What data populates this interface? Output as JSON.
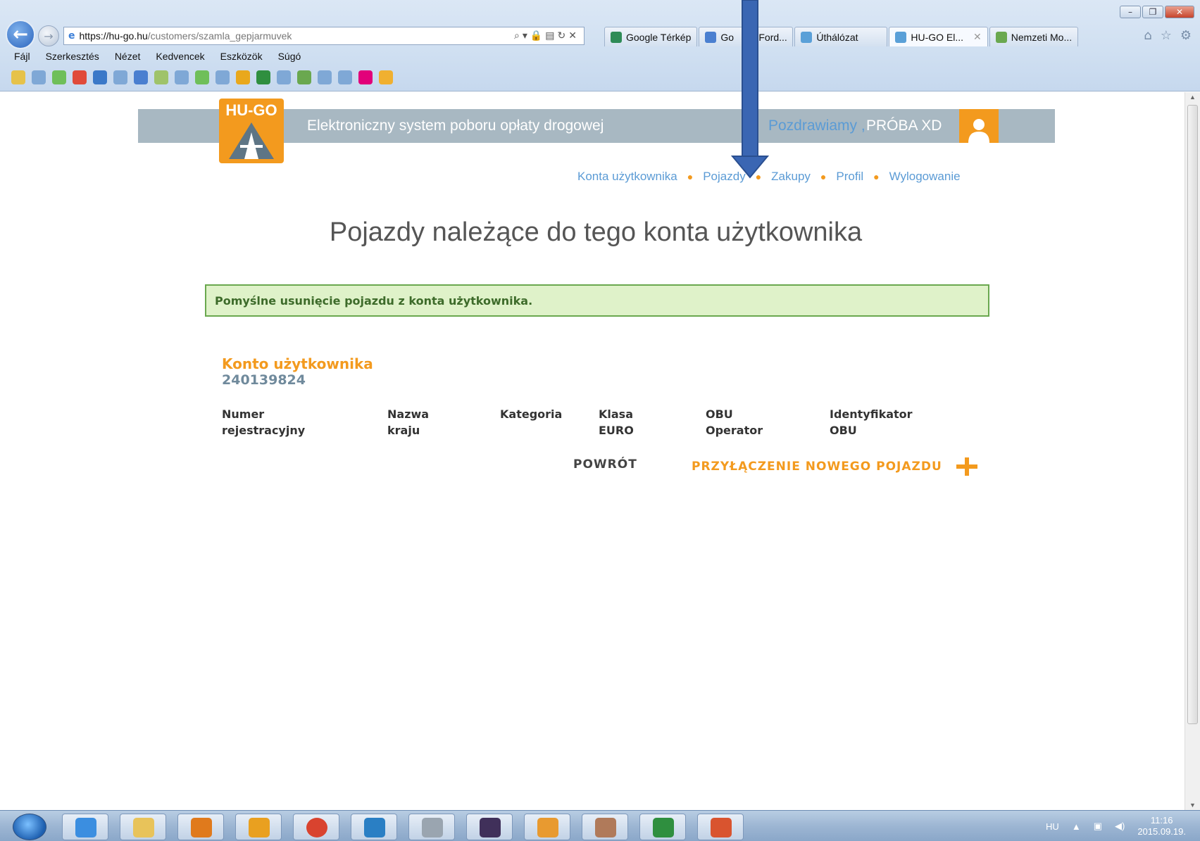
{
  "browser": {
    "url_host": "https://hu-go.hu",
    "url_path": "/customers/szamla_gepjarmuvek",
    "tabs": [
      {
        "label": "Google Térkép",
        "color": "#2e8b57"
      },
      {
        "label": "Go",
        "color": "#4a7fd0"
      },
      {
        "label": "Ford...",
        "color": "#4a7fd0"
      },
      {
        "label": "Úthálózat",
        "color": "#5aa0d8"
      },
      {
        "label": "HU-GO El...",
        "color": "#5aa0d8"
      },
      {
        "label": "Nemzeti Mo...",
        "color": "#6aa84f"
      }
    ],
    "menu": [
      "Fájl",
      "Szerkesztés",
      "Nézet",
      "Kedvencek",
      "Eszközök",
      "Súgó"
    ]
  },
  "header": {
    "logo_text": "HU-GO",
    "system_title": "Elektroniczny system poboru opłaty drogowej",
    "greeting": "Pozdrawiamy ,",
    "username": "PRÓBA XD"
  },
  "nav": {
    "items": [
      "Konta użytkownika",
      "Pojazdy",
      "Zakupy",
      "Profil",
      "Wylogowanie"
    ]
  },
  "main": {
    "heading": "Pojazdy należące do tego konta użytkownika",
    "success_message": "Pomyślne usunięcie pojazdu z konta użytkownika.",
    "account_label": "Konto użytkownika",
    "account_number": "240139824",
    "columns": [
      [
        "Numer",
        "rejestracyjny"
      ],
      [
        "Nazwa",
        "kraju"
      ],
      [
        "Kategoria"
      ],
      [
        "Klasa",
        "EURO"
      ],
      [
        "OBU",
        "Operator"
      ],
      [
        "Identyfikator",
        "OBU"
      ]
    ],
    "back_label": "POWRÓT",
    "add_vehicle_label": "PRZYŁĄCZENIE NOWEGO POJAZDU"
  },
  "taskbar": {
    "lang": "HU",
    "time": "11:16",
    "date": "2015.09.19."
  },
  "colors": {
    "brand_orange": "#f39a1e",
    "link_blue": "#5b9bd5",
    "success_border": "#6aa84f",
    "arrow_blue": "#3a66b3"
  }
}
